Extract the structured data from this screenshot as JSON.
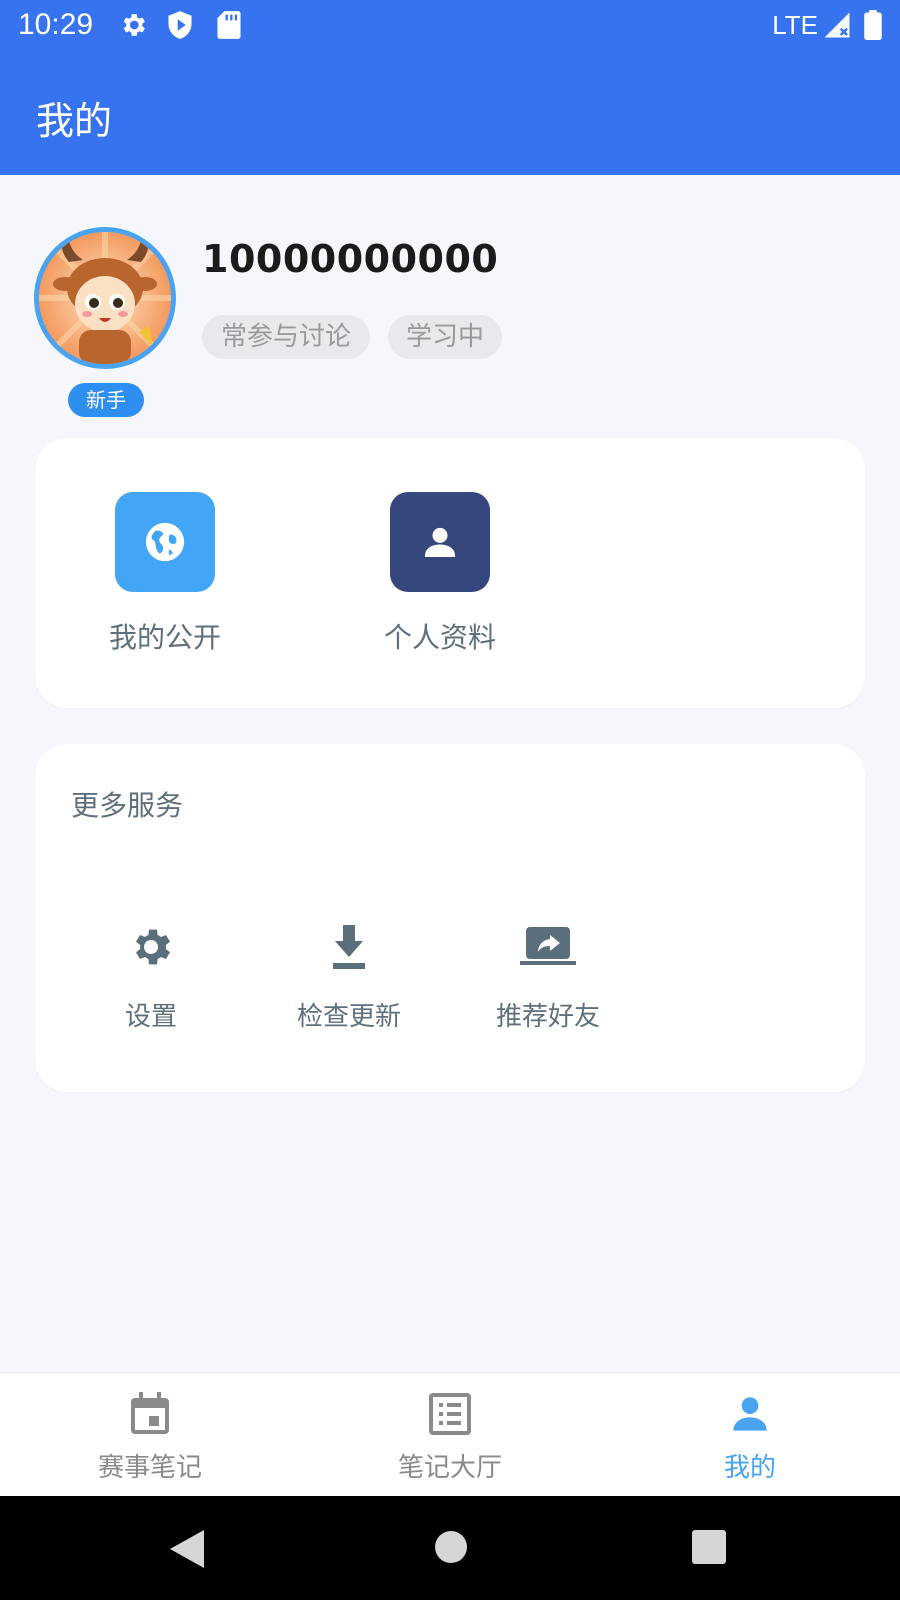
{
  "status_bar": {
    "time": "10:29",
    "network": "LTE",
    "icons": [
      "gear-icon",
      "shield-play-icon",
      "sd-card-icon",
      "signal-icon",
      "battery-icon"
    ]
  },
  "app_bar": {
    "title": "我的"
  },
  "profile": {
    "username": "10000000000",
    "avatar_badge": "新手",
    "tags": [
      "常参与讨论",
      "学习中"
    ]
  },
  "quick_actions": [
    {
      "label": "我的公开",
      "icon": "globe-icon",
      "color": "#42a5f5"
    },
    {
      "label": "个人资料",
      "icon": "person-icon",
      "color": "#35477d"
    }
  ],
  "more_services": {
    "title": "更多服务",
    "items": [
      {
        "label": "设置",
        "icon": "gear-icon"
      },
      {
        "label": "检查更新",
        "icon": "download-icon"
      },
      {
        "label": "推荐好友",
        "icon": "share-icon"
      }
    ]
  },
  "bottom_nav": {
    "items": [
      {
        "label": "赛事笔记",
        "icon": "calendar-icon",
        "active": false
      },
      {
        "label": "笔记大厅",
        "icon": "list-icon",
        "active": false
      },
      {
        "label": "我的",
        "icon": "person-icon",
        "active": true
      }
    ]
  },
  "colors": {
    "primary": "#3773ef",
    "accent": "#4aa3f0",
    "background": "#f6f7fc",
    "text_secondary": "#5f6f7c"
  }
}
